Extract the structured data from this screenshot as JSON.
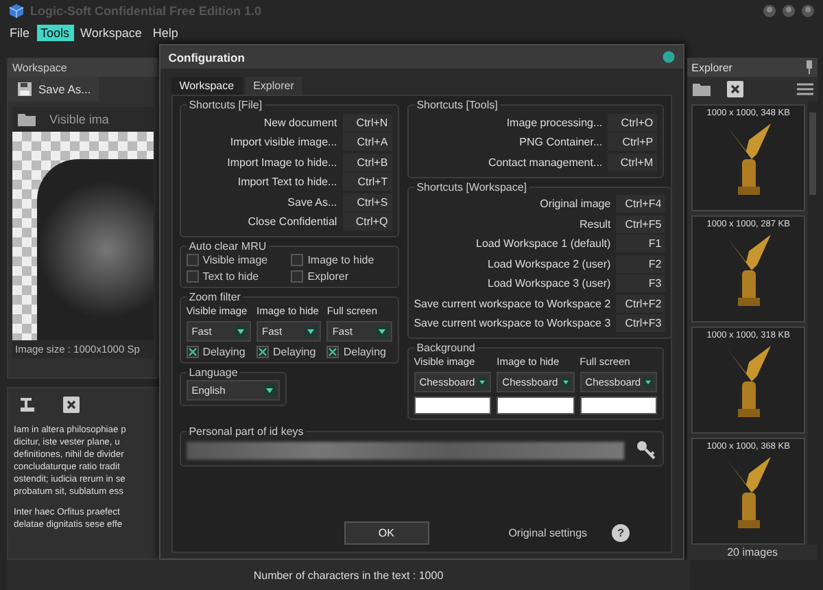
{
  "window": {
    "title": "Logic-Soft Confidential Free Edition 1.0"
  },
  "menu": [
    {
      "label": "File",
      "selected": false
    },
    {
      "label": "Tools",
      "selected": true
    },
    {
      "label": "Workspace",
      "selected": false
    },
    {
      "label": "Help",
      "selected": false
    }
  ],
  "workspace_panel": {
    "title": "Workspace",
    "save_button": "Save As...",
    "image_title": "Visible ima",
    "image_info": "Image size : 1000x1000  Sp",
    "paragraphs": [
      [
        "Iam in altera philosophiae p",
        "dicitur, iste vester plane, u",
        "definitiones, nihil de divider",
        "concludaturque ratio tradit",
        "ostendit; iudicia rerum in se",
        "probatum sit, sublatum ess"
      ],
      [
        "Inter haec Orfitus praefect",
        "delatae dignitatis sese effe"
      ]
    ]
  },
  "status_bar": "Number of characters in the text : 1000",
  "dialog": {
    "title": "Configuration",
    "tabs": [
      {
        "label": "Workspace",
        "selected": true
      },
      {
        "label": "Explorer",
        "selected": false
      }
    ],
    "shortcuts_file": {
      "title": "Shortcuts [File]",
      "rows": [
        {
          "label": "New document",
          "key": "Ctrl+N"
        },
        {
          "label": "Import visible image...",
          "key": "Ctrl+A"
        },
        {
          "label": "Import Image to hide...",
          "key": "Ctrl+B"
        },
        {
          "label": "Import Text to hide...",
          "key": "Ctrl+T"
        },
        {
          "label": "Save As...",
          "key": "Ctrl+S"
        },
        {
          "label": "Close Confidential",
          "key": "Ctrl+Q"
        }
      ]
    },
    "auto_clear_mru": {
      "title": "Auto clear MRU",
      "options": [
        {
          "label": "Visible image",
          "checked": false
        },
        {
          "label": "Image to hide",
          "checked": false
        },
        {
          "label": "Text to hide",
          "checked": false
        },
        {
          "label": "Explorer",
          "checked": false
        }
      ]
    },
    "zoom_filter": {
      "title": "Zoom filter",
      "columns": [
        {
          "label": "Visible image",
          "value": "Fast",
          "delay_label": "Delaying",
          "delaying": true
        },
        {
          "label": "Image to hide",
          "value": "Fast",
          "delay_label": "Delaying",
          "delaying": true
        },
        {
          "label": "Full screen",
          "value": "Fast",
          "delay_label": "Delaying",
          "delaying": true
        }
      ]
    },
    "language": {
      "title": "Language",
      "value": "English"
    },
    "shortcuts_tools": {
      "title": "Shortcuts [Tools]",
      "rows": [
        {
          "label": "Image processing...",
          "key": "Ctrl+O"
        },
        {
          "label": "PNG Container...",
          "key": "Ctrl+P"
        },
        {
          "label": "Contact management...",
          "key": "Ctrl+M"
        }
      ]
    },
    "shortcuts_workspace": {
      "title": "Shortcuts [Workspace]",
      "rows": [
        {
          "label": "Original image",
          "key": "Ctrl+F4"
        },
        {
          "label": "Result",
          "key": "Ctrl+F5"
        },
        {
          "label": "Load Workspace 1 (default)",
          "key": "F1"
        },
        {
          "label": "Load Workspace 2 (user)",
          "key": "F2"
        },
        {
          "label": "Load Workspace 3 (user)",
          "key": "F3"
        },
        {
          "label": "Save current workspace to Workspace 2",
          "key": "Ctrl+F2"
        },
        {
          "label": "Save current workspace to Workspace 3",
          "key": "Ctrl+F3"
        }
      ]
    },
    "background": {
      "title": "Background",
      "columns": [
        {
          "label": "Visible image",
          "value": "Chessboard"
        },
        {
          "label": "Image to hide",
          "value": "Chessboard"
        },
        {
          "label": "Full screen",
          "value": "Chessboard"
        }
      ]
    },
    "id_keys": {
      "title": "Personal part of id keys"
    },
    "ok_button": "OK",
    "original_settings": "Original settings",
    "help_button": "?"
  },
  "explorer": {
    "title": "Explorer",
    "thumbnails": [
      {
        "caption": "1000 x 1000, 348 KB"
      },
      {
        "caption": "1000 x 1000, 287 KB"
      },
      {
        "caption": "1000 x 1000, 318 KB"
      },
      {
        "caption": "1000 x 1000, 368 KB"
      }
    ],
    "count": "20 images"
  }
}
